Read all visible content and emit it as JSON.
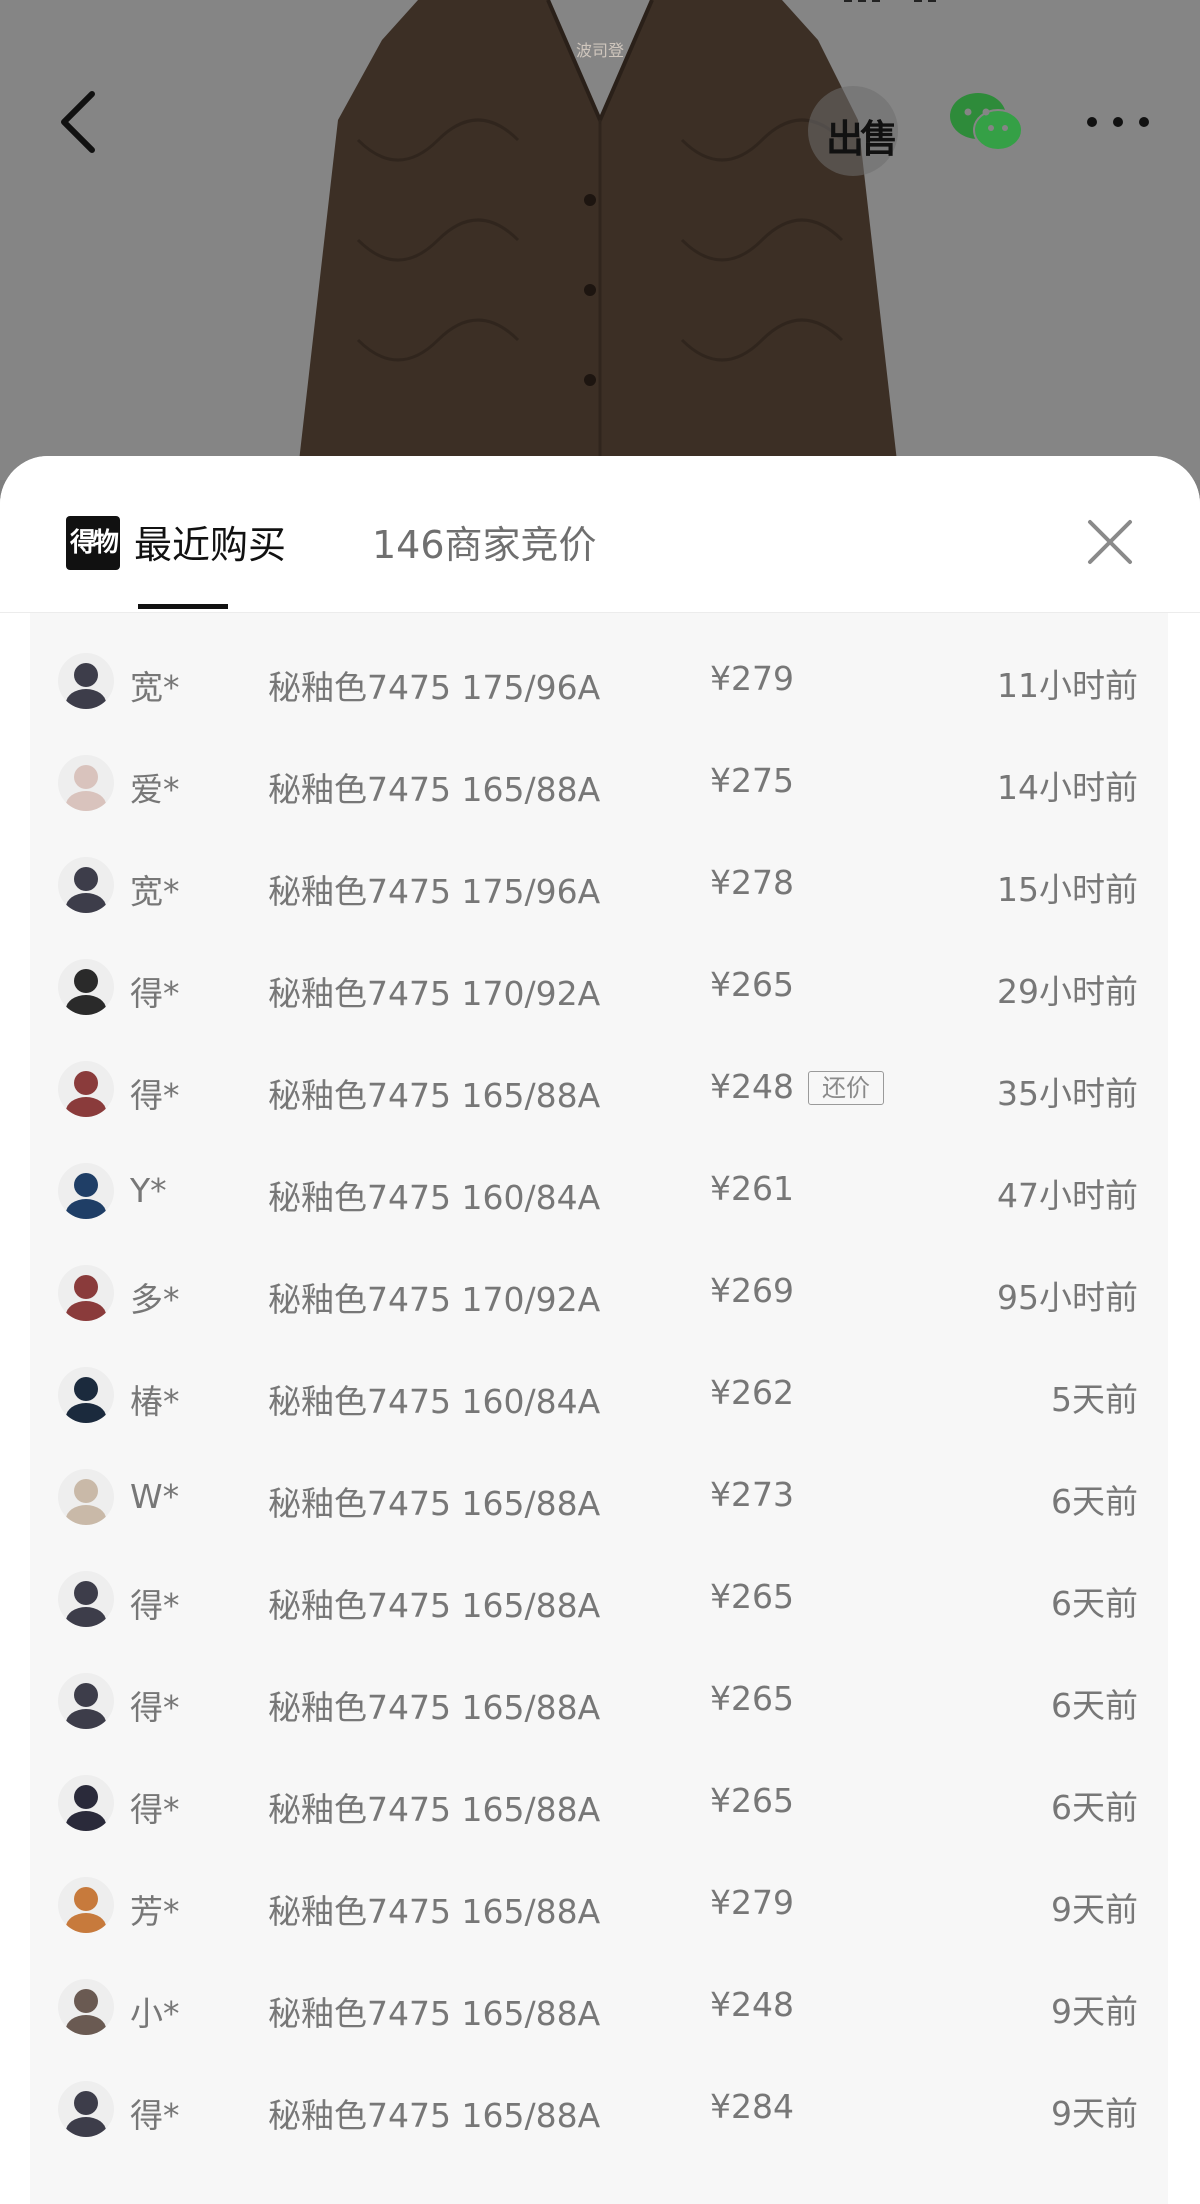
{
  "top_bar": {
    "sell_label": "出售",
    "back_icon": "chevron-left-icon",
    "wechat_icon": "wechat-icon",
    "more_icon": "more-dots-icon"
  },
  "product_image": {
    "brand_text": "波司登"
  },
  "sheet": {
    "logo_text": "得物",
    "tabs": [
      {
        "label": "最近购买",
        "active": true
      },
      {
        "label": "146商家竞价",
        "active": false
      }
    ],
    "close_icon": "close-icon"
  },
  "purchases": [
    {
      "user": "宽*",
      "spec": "秘釉色7475 175/96A",
      "price": "¥279",
      "tag": "",
      "time": "11小时前",
      "avatar": "#3d3d4a"
    },
    {
      "user": "爱*",
      "spec": "秘釉色7475 165/88A",
      "price": "¥275",
      "tag": "",
      "time": "14小时前",
      "avatar": "#d9c3bd"
    },
    {
      "user": "宽*",
      "spec": "秘釉色7475 175/96A",
      "price": "¥278",
      "tag": "",
      "time": "15小时前",
      "avatar": "#3d3d4a"
    },
    {
      "user": "得*",
      "spec": "秘釉色7475 170/92A",
      "price": "¥265",
      "tag": "",
      "time": "29小时前",
      "avatar": "#2a2a2a"
    },
    {
      "user": "得*",
      "spec": "秘釉色7475 165/88A",
      "price": "¥248",
      "tag": "还价",
      "time": "35小时前",
      "avatar": "#8a3b3b"
    },
    {
      "user": "Y*",
      "spec": "秘釉色7475 160/84A",
      "price": "¥261",
      "tag": "",
      "time": "47小时前",
      "avatar": "#1f3e66"
    },
    {
      "user": "多*",
      "spec": "秘釉色7475 170/92A",
      "price": "¥269",
      "tag": "",
      "time": "95小时前",
      "avatar": "#8a3b3b"
    },
    {
      "user": "椿*",
      "spec": "秘釉色7475 160/84A",
      "price": "¥262",
      "tag": "",
      "time": "5天前",
      "avatar": "#1b2a3d"
    },
    {
      "user": "W*",
      "spec": "秘釉色7475 165/88A",
      "price": "¥273",
      "tag": "",
      "time": "6天前",
      "avatar": "#c9b9a8"
    },
    {
      "user": "得*",
      "spec": "秘釉色7475 165/88A",
      "price": "¥265",
      "tag": "",
      "time": "6天前",
      "avatar": "#3d3d4a"
    },
    {
      "user": "得*",
      "spec": "秘釉色7475 165/88A",
      "price": "¥265",
      "tag": "",
      "time": "6天前",
      "avatar": "#3d3d4a"
    },
    {
      "user": "得*",
      "spec": "秘釉色7475 165/88A",
      "price": "¥265",
      "tag": "",
      "time": "6天前",
      "avatar": "#2a2a3a"
    },
    {
      "user": "芳*",
      "spec": "秘釉色7475 165/88A",
      "price": "¥279",
      "tag": "",
      "time": "9天前",
      "avatar": "#c77a3c"
    },
    {
      "user": "小*",
      "spec": "秘釉色7475 165/88A",
      "price": "¥248",
      "tag": "",
      "time": "9天前",
      "avatar": "#6a5a52"
    },
    {
      "user": "得*",
      "spec": "秘釉色7475 165/88A",
      "price": "¥284",
      "tag": "",
      "time": "9天前",
      "avatar": "#3d3d4a"
    }
  ],
  "colors": {
    "sheet_bg": "#ffffff",
    "list_bg": "#f7f7f7",
    "text_muted": "#777777",
    "wechat_green": "#2e8b3a"
  }
}
